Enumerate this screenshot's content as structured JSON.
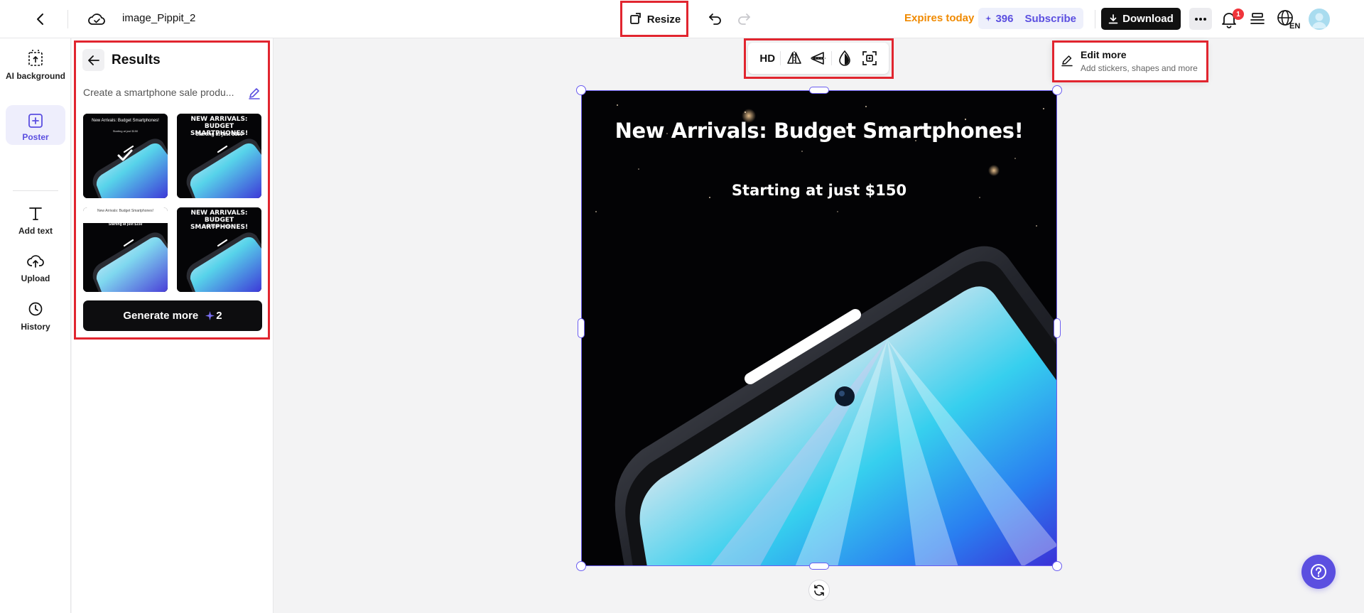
{
  "header": {
    "filename": "image_Pippit_2(",
    "resize_label": "Resize",
    "expires_label": "Expires today",
    "credits": "396",
    "subscribe_label": "Subscribe",
    "download_label": "Download",
    "notification_count": "1",
    "language": "EN"
  },
  "sidebar": {
    "items": [
      {
        "label": "AI background",
        "icon": "ai-background-icon"
      },
      {
        "label": "Poster",
        "icon": "poster-icon",
        "active": true
      },
      {
        "label": "Add text",
        "icon": "text-icon"
      },
      {
        "label": "Upload",
        "icon": "upload-icon"
      },
      {
        "label": "History",
        "icon": "history-icon"
      }
    ]
  },
  "results": {
    "title": "Results",
    "prompt": "Create a smartphone sale produ...",
    "thumbnails": [
      {
        "line1": "New Arrivals: Budget Smartphones!",
        "line2": "Starting at just $150",
        "selected": true
      },
      {
        "line1": "NEW ARRIVALS: BUDGET SMARTPHONES!",
        "line2": "Starting at just $150"
      },
      {
        "line1": "New Arrivals: Budget Smartphones!",
        "line2": "Starting at just $150"
      },
      {
        "line1": "NEW ARRIVALS: BUDGET SMARTPHONES!",
        "line2": "Starting at just $150"
      }
    ],
    "generate_label": "Generate more",
    "generate_cost": "2"
  },
  "toolbar": {
    "hd_label": "HD"
  },
  "poster": {
    "headline": "New Arrivals: Budget Smartphones!",
    "subline": "Starting at just $150"
  },
  "dropdown": {
    "title": "Edit more",
    "subtitle": "Add stickers, shapes and more"
  },
  "colors": {
    "accent": "#5b4fe0",
    "warning": "#f08a00",
    "highlight": "#e1252f"
  }
}
